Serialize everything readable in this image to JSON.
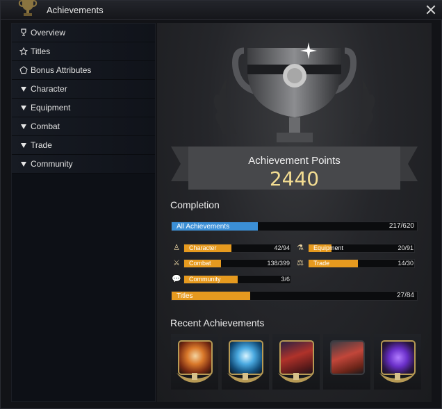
{
  "window": {
    "title": "Achievements",
    "close_icon": "close-icon"
  },
  "sidebar": {
    "items": [
      {
        "label": "Overview",
        "icon": "trophy-icon"
      },
      {
        "label": "Titles",
        "icon": "star-icon"
      },
      {
        "label": "Bonus Attributes",
        "icon": "pentagon-icon"
      },
      {
        "label": "Character",
        "icon": "expand-arrow-icon"
      },
      {
        "label": "Equipment",
        "icon": "expand-arrow-icon"
      },
      {
        "label": "Combat",
        "icon": "expand-arrow-icon"
      },
      {
        "label": "Trade",
        "icon": "expand-arrow-icon"
      },
      {
        "label": "Community",
        "icon": "expand-arrow-icon"
      }
    ]
  },
  "summary": {
    "points_label": "Achievement Points",
    "points_value": "2440"
  },
  "completion": {
    "title": "Completion",
    "all": {
      "label": "All Achievements",
      "count": "217/620",
      "done": 217,
      "total": 620,
      "color": "#3b8fd6"
    },
    "categories": [
      {
        "label": "Character",
        "count": "42/94",
        "done": 42,
        "total": 94,
        "icon": "character-icon",
        "color": "#e69a1f"
      },
      {
        "label": "Equipment",
        "count": "20/91",
        "done": 20,
        "total": 91,
        "icon": "equipment-icon",
        "color": "#e69a1f"
      },
      {
        "label": "Combat",
        "count": "138/399",
        "done": 138,
        "total": 399,
        "icon": "crossed-swords-icon",
        "color": "#e69a1f"
      },
      {
        "label": "Trade",
        "count": "14/30",
        "done": 14,
        "total": 30,
        "icon": "scales-icon",
        "color": "#e69a1f"
      },
      {
        "label": "Community",
        "count": "3/6",
        "done": 3,
        "total": 6,
        "icon": "chat-bubble-icon",
        "color": "#e69a1f"
      }
    ],
    "titles": {
      "label": "Titles",
      "count": "27/84",
      "done": 27,
      "total": 84,
      "color": "#e69a1f"
    }
  },
  "recent": {
    "title": "Recent Achievements",
    "items": [
      {
        "icon": "orange-compass-badge-icon"
      },
      {
        "icon": "blue-compass-badge-icon"
      },
      {
        "icon": "red-haired-warrior-badge-icon"
      },
      {
        "icon": "red-haired-fighter-badge-icon"
      },
      {
        "icon": "purple-crystal-badge-icon"
      }
    ]
  }
}
